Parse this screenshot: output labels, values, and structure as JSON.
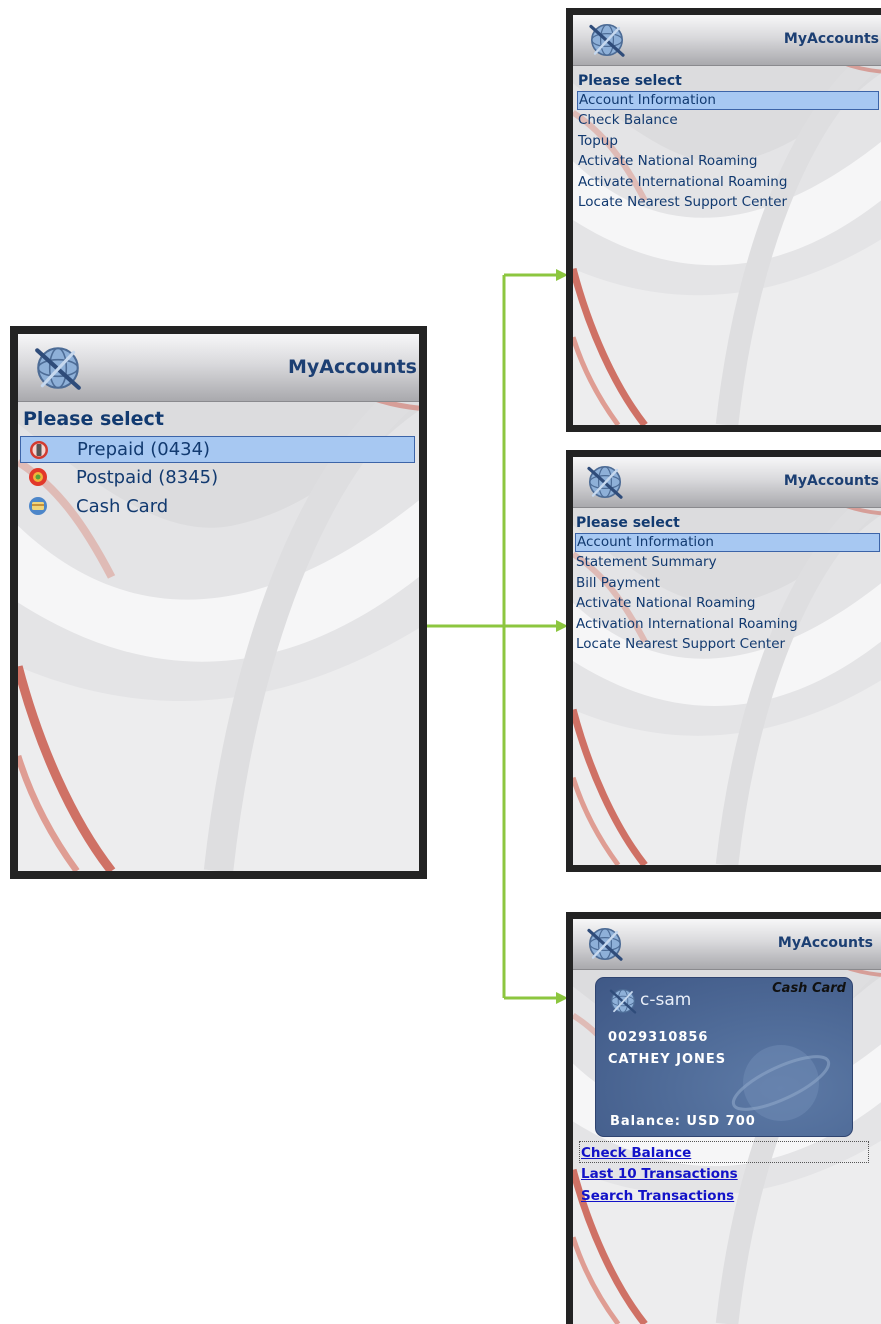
{
  "app": {
    "title": "MyAccounts"
  },
  "main_screen": {
    "heading": "Please select",
    "items": [
      {
        "label": "Prepaid (0434)",
        "icon": "mobile-phone-icon"
      },
      {
        "label": "Postpaid (8345)",
        "icon": "postpaid-icon"
      },
      {
        "label": "Cash Card",
        "icon": "card-icon"
      }
    ]
  },
  "prepaid_screen": {
    "heading": "Please select",
    "items": [
      "Account Information",
      "Check Balance",
      "Topup",
      "Activate National Roaming",
      "Activate International Roaming",
      "Locate Nearest Support Center"
    ]
  },
  "postpaid_screen": {
    "heading": "Please select",
    "items": [
      "Account Information",
      "Statement Summary",
      "Bill Payment",
      "Activate National Roaming",
      "Activation International Roaming",
      "Locate Nearest Support Center"
    ]
  },
  "cashcard_screen": {
    "card": {
      "brand": "c-sam",
      "type": "Cash Card",
      "number": "0029310856",
      "holder": "CATHEY JONES",
      "balance": "Balance: USD 700"
    },
    "links": [
      "Check Balance",
      "Last 10 Transactions",
      "Search Transactions"
    ]
  },
  "colors": {
    "accent": "#1c3f73",
    "selection": "#a7c8f2",
    "arrow": "#8cc63f",
    "link": "#1313c8"
  }
}
